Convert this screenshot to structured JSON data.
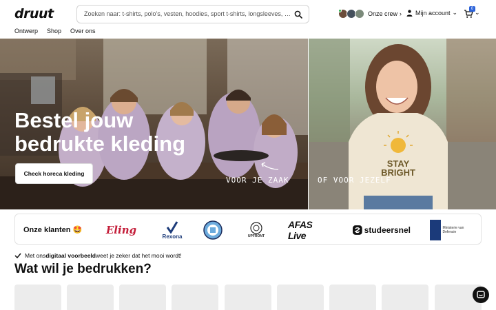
{
  "brand": {
    "logo_text": "druut"
  },
  "search": {
    "placeholder": "Zoeken naar: t-shirts, polo's, vesten, hoodies, sport t-shirts, longsleeves, overhemd..."
  },
  "header": {
    "crew_label": "Onze crew",
    "account_label": "Mijn account",
    "cart_count": "0"
  },
  "nav": {
    "items": [
      "Ontwerp",
      "Shop",
      "Over ons"
    ]
  },
  "hero": {
    "title_line1": "Bestel jouw",
    "title_line2": "bedrukte kleding",
    "button_label": "Check horeca kleding",
    "left_caption": "VOOR JE ZAAK",
    "right_caption": "OF VOOR JEZELF",
    "shirt_print_line1": "STAY",
    "shirt_print_line2": "BRIGHT"
  },
  "clients": {
    "label": "Onze klanten 🤩",
    "logos": [
      "Eling",
      "Rexona",
      "Manchester City",
      "UPFRONT",
      "AFAS Live",
      "studeersnel",
      "Ministerie van Defensie"
    ]
  },
  "notice": {
    "prefix": "Met ons ",
    "bold": "digitaal voorbeeld",
    "suffix": " weet je zeker dat het mooi wordt!"
  },
  "section": {
    "title": "Wat wil je bedrukken?"
  },
  "colors": {
    "accent": "#2b62d9",
    "crew_online": "#27b34c",
    "tile_bg": "#ececec"
  }
}
